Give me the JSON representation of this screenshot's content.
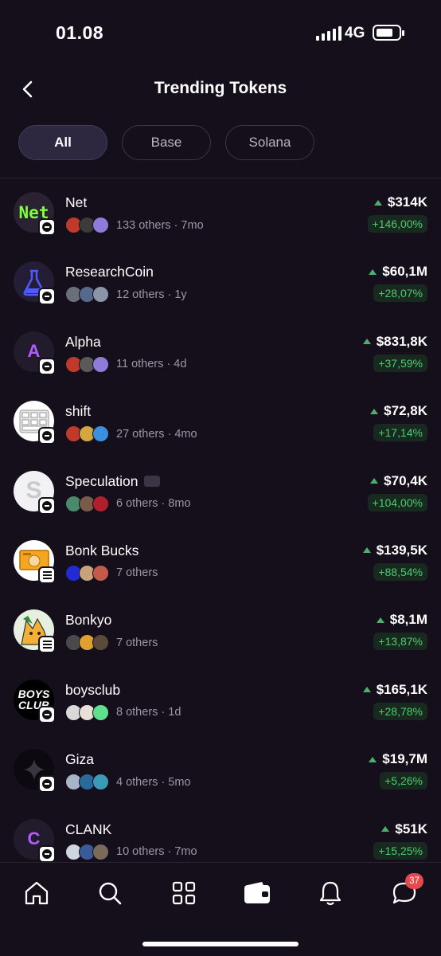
{
  "status_bar": {
    "time": "01.08",
    "network": "4G"
  },
  "header": {
    "title": "Trending Tokens"
  },
  "filters": [
    {
      "label": "All",
      "active": true
    },
    {
      "label": "Base",
      "active": false
    },
    {
      "label": "Solana",
      "active": false
    }
  ],
  "tokens": [
    {
      "name": "Net",
      "holders_text": "133 others",
      "age": "· 7mo",
      "price": "$314K",
      "change": "+146,00%",
      "chain": "base"
    },
    {
      "name": "ResearchCoin",
      "holders_text": "12 others",
      "age": "· 1y",
      "price": "$60,1M",
      "change": "+28,07%",
      "chain": "base"
    },
    {
      "name": "Alpha",
      "holders_text": "11 others",
      "age": "· 4d",
      "price": "$831,8K",
      "change": "+37,59%",
      "chain": "base"
    },
    {
      "name": "shift",
      "holders_text": "27 others",
      "age": "· 4mo",
      "price": "$72,8K",
      "change": "+17,14%",
      "chain": "base"
    },
    {
      "name": "Speculation",
      "holders_text": "6 others",
      "age": "· 8mo",
      "price": "$70,4K",
      "change": "+104,00%",
      "chain": "base"
    },
    {
      "name": "Bonk Bucks",
      "holders_text": "7 others",
      "age": "",
      "price": "$139,5K",
      "change": "+88,54%",
      "chain": "solana"
    },
    {
      "name": "Bonkyo",
      "holders_text": "7 others",
      "age": "",
      "price": "$8,1M",
      "change": "+13,87%",
      "chain": "solana"
    },
    {
      "name": "boysclub",
      "holders_text": "8 others",
      "age": "· 1d",
      "price": "$165,1K",
      "change": "+28,78%",
      "chain": "base"
    },
    {
      "name": "Giza",
      "holders_text": "4 others",
      "age": "· 5mo",
      "price": "$19,7M",
      "change": "+5,26%",
      "chain": "base"
    },
    {
      "name": "CLANK",
      "holders_text": "10 others",
      "age": "· 7mo",
      "price": "$51K",
      "change": "+15,25%",
      "chain": "base"
    }
  ],
  "logos": {
    "net": "Net",
    "alpha": "A",
    "speculation": "S",
    "boysclub_line1": "BOYS",
    "boysclub_line2": "CLUB",
    "clank": "C"
  },
  "bottom_nav": {
    "items": [
      "home-icon",
      "search-icon",
      "grid-icon",
      "wallet-icon",
      "bell-icon",
      "chat-icon"
    ],
    "notification_count": "37"
  },
  "colors": {
    "background": "#150f1c",
    "positive": "#4ccb6c",
    "badge": "#e5484d",
    "active_chip": "#2e2740"
  }
}
